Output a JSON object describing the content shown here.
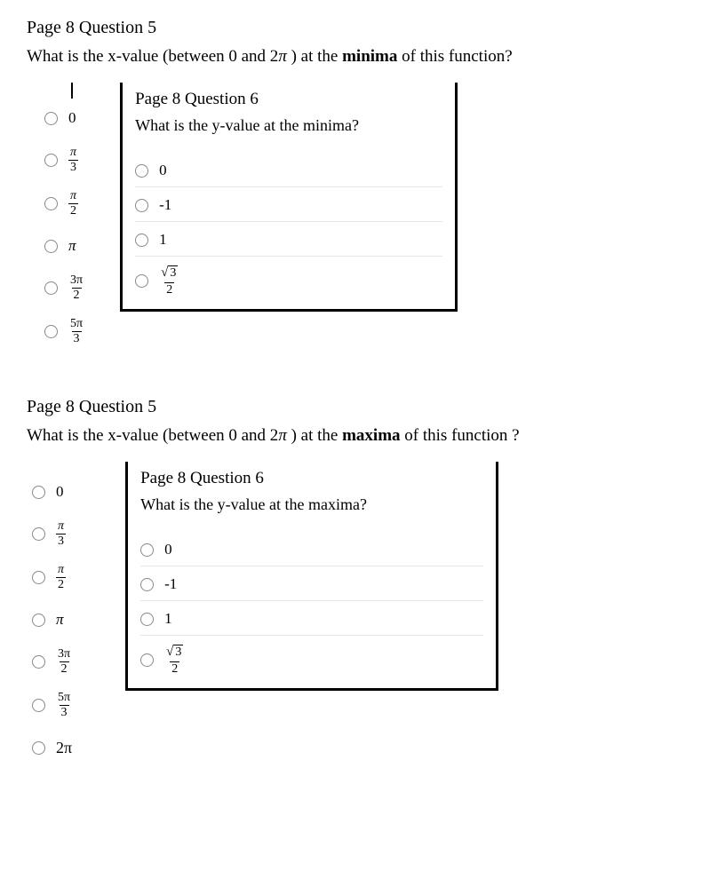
{
  "block1": {
    "left": {
      "title": "Page 8 Question 5",
      "prompt_pre": "What is the x-value (between 0 and 2",
      "prompt_pi": "π",
      "prompt_post": " ) at the ",
      "prompt_emph": "minima",
      "prompt_tail": " of this function?",
      "options": {
        "o1": "0",
        "o2_num": "π",
        "o2_den": "3",
        "o3_num": "π",
        "o3_den": "2",
        "o4": "π",
        "o5_num": "3π",
        "o5_den": "2",
        "o6_num": "5π",
        "o6_den": "3"
      }
    },
    "right": {
      "title": "Page 8 Question 6",
      "prompt": "What is the y-value at the minima?",
      "options": {
        "o1": "0",
        "o2": "-1",
        "o3": "1",
        "o4_rad": "3",
        "o4_den": "2"
      }
    }
  },
  "block2": {
    "left": {
      "title": "Page 8 Question 5",
      "prompt_pre": "What is the x-value (between 0 and 2",
      "prompt_pi": "π",
      "prompt_post": " ) at the ",
      "prompt_emph": "maxima",
      "prompt_tail": " of this function ?",
      "options": {
        "o1": "0",
        "o2_num": "π",
        "o2_den": "3",
        "o3_num": "π",
        "o3_den": "2",
        "o4": "π",
        "o5_num": "3π",
        "o5_den": "2",
        "o6_num": "5π",
        "o6_den": "3",
        "o7": "2π"
      }
    },
    "right": {
      "title": "Page 8 Question 6",
      "prompt": "What is the y-value at the maxima?",
      "options": {
        "o1": "0",
        "o2": "-1",
        "o3": "1",
        "o4_rad": "3",
        "o4_den": "2"
      }
    }
  }
}
